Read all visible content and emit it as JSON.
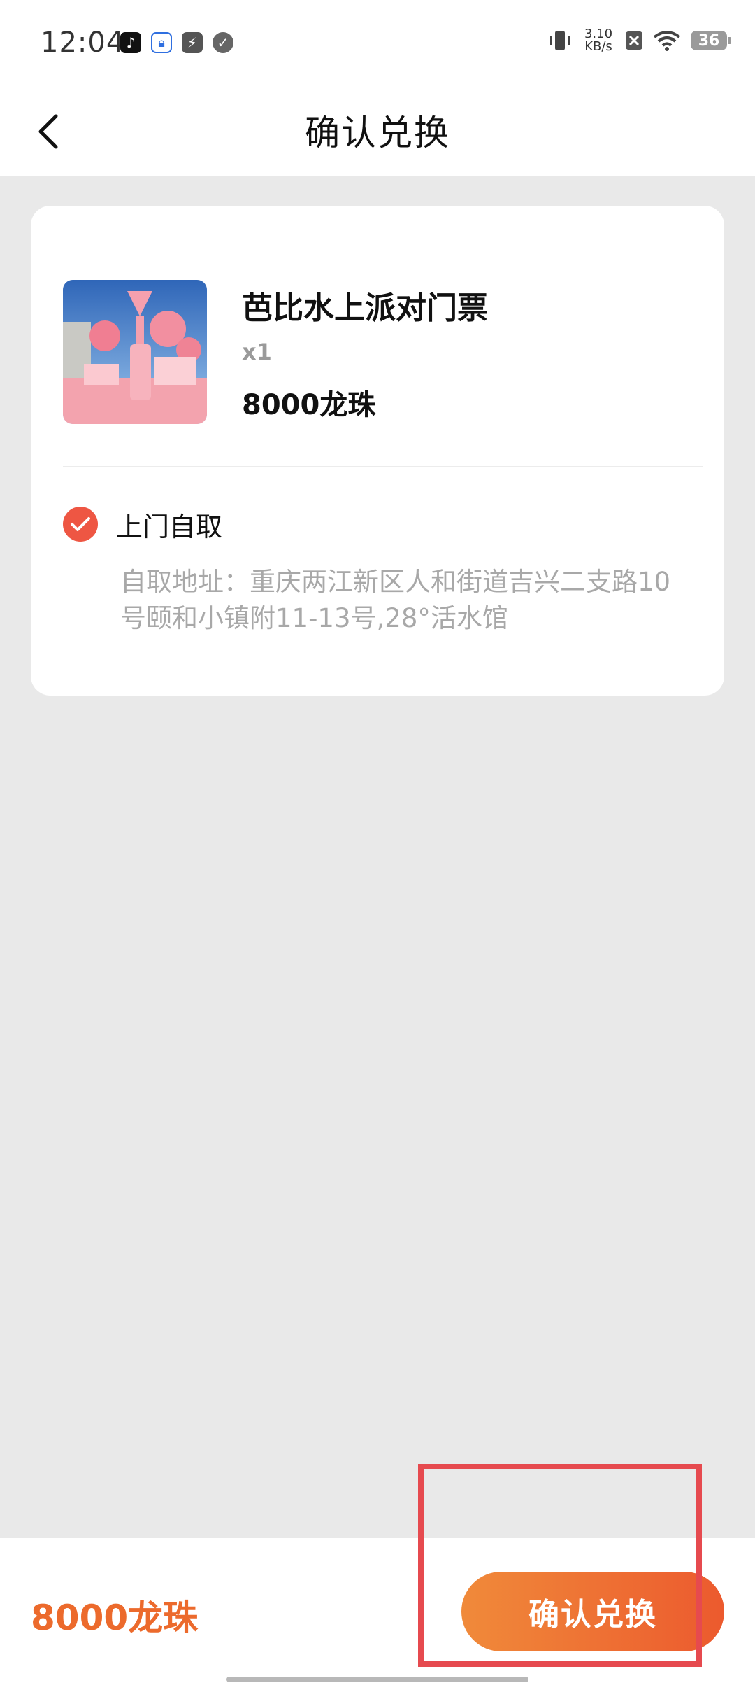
{
  "status_bar": {
    "time": "12:04",
    "net_speed_value": "3.10",
    "net_speed_unit": "KB/s",
    "battery": "36",
    "icons": [
      "tiktok-icon",
      "lock-app-icon",
      "flash-app-icon",
      "check-app-icon",
      "vibrate-icon",
      "sim-off-icon",
      "wifi-icon",
      "battery-icon"
    ]
  },
  "nav": {
    "title": "确认兑换",
    "back_icon": "chevron-left-icon"
  },
  "product": {
    "name": "芭比水上派对门票",
    "quantity": "x1",
    "price": "8000龙珠"
  },
  "pickup": {
    "label": "上门自取",
    "address": "自取地址：重庆两江新区人和街道吉兴二支路10号颐和小镇附11-13号,28°活水馆",
    "selected": true
  },
  "footer": {
    "total": "8000龙珠",
    "confirm_label": "确认兑换"
  },
  "colors": {
    "accent": "#ec6a2c",
    "check": "#ee5643",
    "annotation": "#e64a4f"
  }
}
